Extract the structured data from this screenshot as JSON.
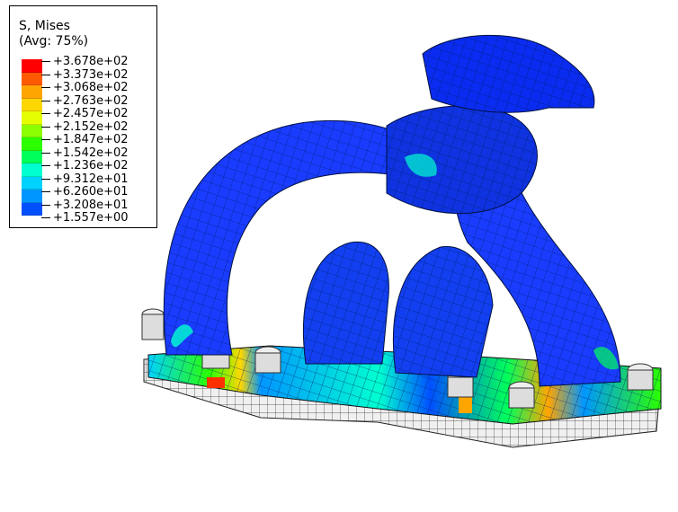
{
  "legend": {
    "title": "S, Mises",
    "subtitle": "(Avg: 75%)",
    "levels": [
      {
        "label": "+3.678e+02",
        "color": "#ff0000"
      },
      {
        "label": "+3.373e+02",
        "color": "#ff5a00"
      },
      {
        "label": "+3.068e+02",
        "color": "#ffa500"
      },
      {
        "label": "+2.763e+02",
        "color": "#ffd700"
      },
      {
        "label": "+2.457e+02",
        "color": "#e6ff00"
      },
      {
        "label": "+2.152e+02",
        "color": "#8cff00"
      },
      {
        "label": "+1.847e+02",
        "color": "#2bff00"
      },
      {
        "label": "+1.542e+02",
        "color": "#00ff5a"
      },
      {
        "label": "+1.236e+02",
        "color": "#00ffd0"
      },
      {
        "label": "+9.312e+01",
        "color": "#00d2ff"
      },
      {
        "label": "+6.260e+01",
        "color": "#0096ff"
      },
      {
        "label": "+3.208e+01",
        "color": "#0050ff"
      },
      {
        "label": "+1.557e+00",
        "color": "#0000ff"
      }
    ]
  }
}
